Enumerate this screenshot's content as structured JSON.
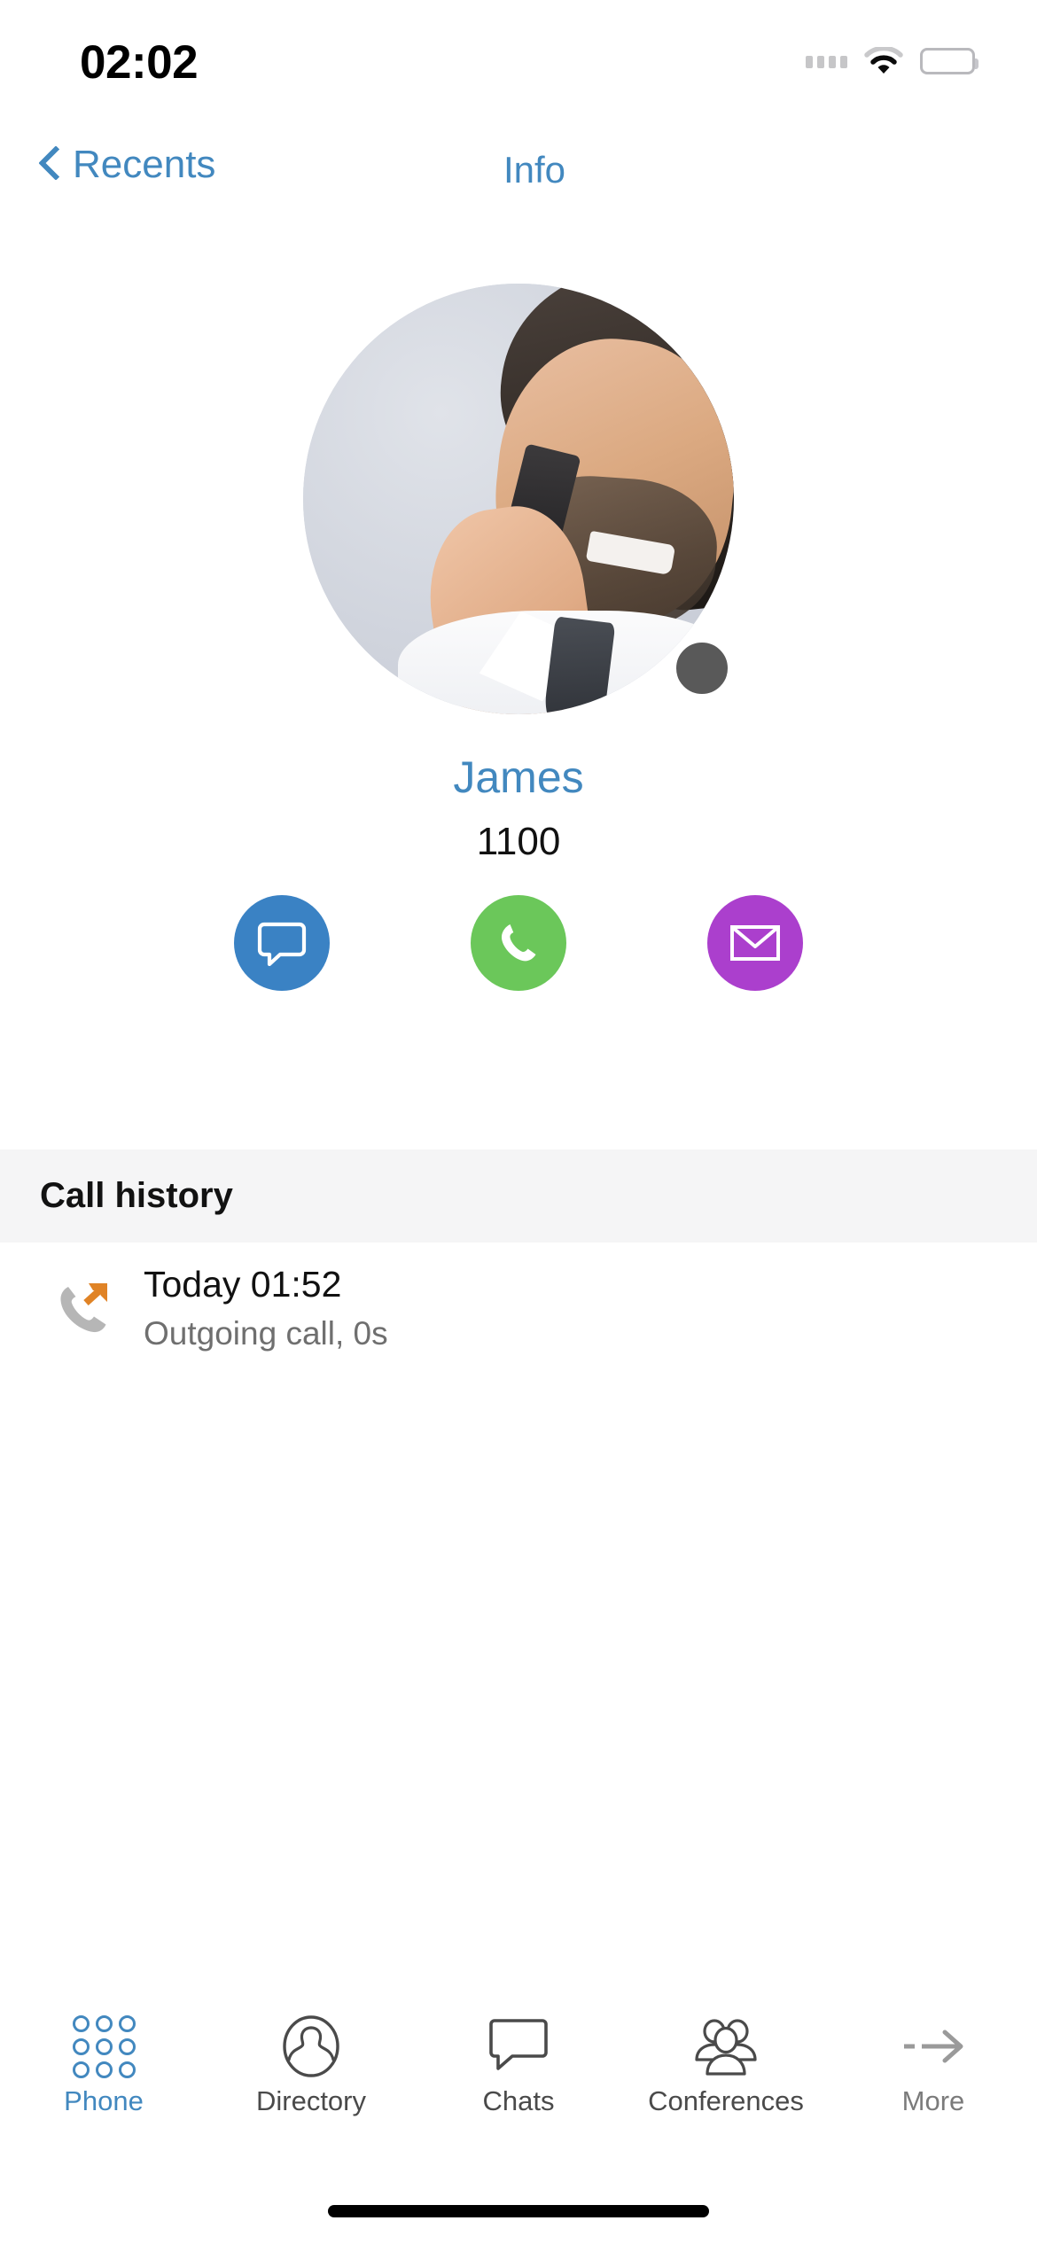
{
  "status_bar": {
    "time": "02:02",
    "signal_icon": "signal-dots-icon",
    "wifi_icon": "wifi-icon",
    "battery_icon": "battery-full-icon"
  },
  "nav": {
    "back_label": "Recents",
    "back_icon": "chevron-left-icon",
    "title": "Info"
  },
  "contact": {
    "name": "James",
    "extension": "1100",
    "avatar_alt": "contact-photo",
    "presence": "offline",
    "presence_color": "#595959"
  },
  "actions": [
    {
      "name": "chat",
      "label": "Chat",
      "icon": "chat-bubble-icon",
      "color": "#3a82c4"
    },
    {
      "name": "call",
      "label": "Call",
      "icon": "phone-handset-icon",
      "color": "#6bc75a"
    },
    {
      "name": "mail",
      "label": "Mail",
      "icon": "envelope-icon",
      "color": "#ab3fcd"
    }
  ],
  "call_history": {
    "section_title": "Call history",
    "rows": [
      {
        "icon": "outgoing-call-icon",
        "title": "Today  01:52",
        "subtitle": "Outgoing call, 0s"
      }
    ]
  },
  "tabbar": {
    "items": [
      {
        "label": "Phone",
        "icon": "dialpad-icon",
        "active": true
      },
      {
        "label": "Directory",
        "icon": "person-circle-icon",
        "active": false
      },
      {
        "label": "Chats",
        "icon": "chat-bubble-outline-icon",
        "active": false
      },
      {
        "label": "Conferences",
        "icon": "people-group-icon",
        "active": false
      },
      {
        "label": "More",
        "icon": "dashed-arrow-right-icon",
        "active": false
      }
    ]
  },
  "colors": {
    "accent_blue": "#4288bf",
    "green": "#6bc75a",
    "purple": "#ab3fcd",
    "orange": "#e08326",
    "section_bg": "#f5f5f6"
  }
}
